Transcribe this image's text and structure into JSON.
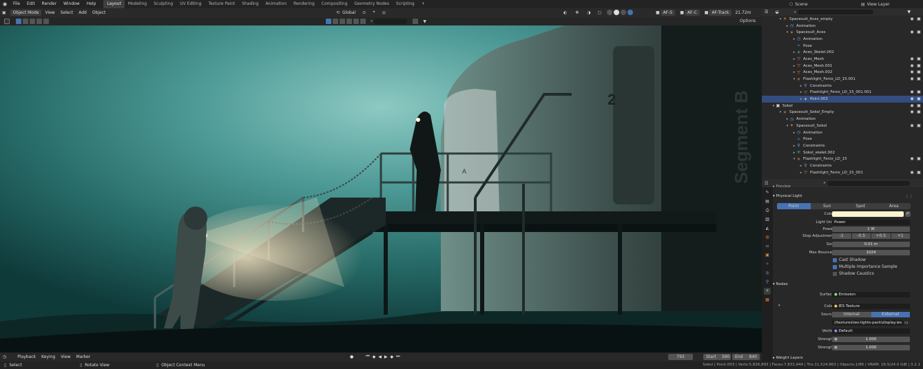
{
  "menu": [
    "File",
    "Edit",
    "Render",
    "Window",
    "Help"
  ],
  "workspaces": [
    "Layout",
    "Modeling",
    "Sculpting",
    "UV Editing",
    "Texture Paint",
    "Shading",
    "Animation",
    "Rendering",
    "Compositing",
    "Geometry Nodes",
    "Scripting"
  ],
  "workspace_add": "+",
  "scene": "Scene",
  "view_layer": "View Layer",
  "viewport_header": {
    "mode": "Object Mode",
    "menus": [
      "View",
      "Select",
      "Add",
      "Object"
    ],
    "orientation": "Global",
    "af_s": "AF-S",
    "af_c": "AF-C",
    "af_track": "AF-Track",
    "focal": "21.72m",
    "options": "Options"
  },
  "outliner": [
    {
      "label": "Spacesuit_Aces_empty",
      "indent": 1,
      "icon": "empty",
      "color": "#e58b3a",
      "caret": "▾",
      "vis": true
    },
    {
      "label": "Animation",
      "indent": 2,
      "icon": "anim",
      "color": "#6aa6e8",
      "caret": "▸",
      "vis": false
    },
    {
      "label": "Spacesuit_Aces",
      "indent": 2,
      "icon": "armature",
      "color": "#e58b3a",
      "caret": "▾",
      "vis": true
    },
    {
      "label": "Animation",
      "indent": 3,
      "icon": "anim",
      "color": "#6aa6e8",
      "caret": "▸",
      "vis": false
    },
    {
      "label": "Pose",
      "indent": 3,
      "icon": "pose",
      "color": "#6aa6e8",
      "caret": "",
      "vis": false
    },
    {
      "label": "Aces_Skelet.002",
      "indent": 3,
      "icon": "armdata",
      "color": "#3ec3a8",
      "caret": "▸",
      "vis": false
    },
    {
      "label": "Aces_Mesh",
      "indent": 3,
      "icon": "mesh",
      "color": "#e58b3a",
      "caret": "▸",
      "vis": true
    },
    {
      "label": "Aces_Mesh.001",
      "indent": 3,
      "icon": "mesh",
      "color": "#e58b3a",
      "caret": "▸",
      "vis": true
    },
    {
      "label": "Aces_Mesh.002",
      "indent": 3,
      "icon": "mesh",
      "color": "#e58b3a",
      "caret": "▸",
      "vis": true
    },
    {
      "label": "Flashlight_Fenix_LD_15.001",
      "indent": 3,
      "icon": "empty",
      "color": "#e58b3a",
      "caret": "▾",
      "vis": true
    },
    {
      "label": "Constraints",
      "indent": 4,
      "icon": "constraint",
      "color": "#6aa6e8",
      "caret": "▸",
      "vis": false
    },
    {
      "label": "Flashlight_Fenix_LD_15_001.001",
      "indent": 4,
      "icon": "mesh",
      "color": "#e58b3a",
      "caret": "▸",
      "vis": true
    },
    {
      "label": "Point.003",
      "indent": 4,
      "icon": "light",
      "color": "#e0e0a0",
      "caret": "▸",
      "vis": true,
      "selected": true
    },
    {
      "label": "Sokol",
      "indent": 0,
      "icon": "collection",
      "color": "#dddddd",
      "caret": "▾",
      "vis": true
    },
    {
      "label": "Spacesuit_Sokol_Empty",
      "indent": 1,
      "icon": "empty",
      "color": "#e58b3a",
      "caret": "▾",
      "vis": true
    },
    {
      "label": "Animation",
      "indent": 2,
      "icon": "anim",
      "color": "#6aa6e8",
      "caret": "▸",
      "vis": false
    },
    {
      "label": "Spacesuit_Sokol",
      "indent": 2,
      "icon": "armature",
      "color": "#e58b3a",
      "caret": "▾",
      "vis": true
    },
    {
      "label": "Animation",
      "indent": 3,
      "icon": "anim",
      "color": "#6aa6e8",
      "caret": "▸",
      "vis": false
    },
    {
      "label": "Pose",
      "indent": 3,
      "icon": "pose",
      "color": "#6aa6e8",
      "caret": "",
      "vis": false
    },
    {
      "label": "Constraints",
      "indent": 3,
      "icon": "constraint",
      "color": "#6aa6e8",
      "caret": "▸",
      "vis": false
    },
    {
      "label": "Sokol_skelet.002",
      "indent": 3,
      "icon": "armdata",
      "color": "#3ec3a8",
      "caret": "▸",
      "vis": false
    },
    {
      "label": "Flashlight_Fenix_LD_15",
      "indent": 3,
      "icon": "empty",
      "color": "#e58b3a",
      "caret": "▾",
      "vis": true
    },
    {
      "label": "Constraints",
      "indent": 4,
      "icon": "constraint",
      "color": "#6aa6e8",
      "caret": "▸",
      "vis": false
    },
    {
      "label": "Flashlight_Fenix_LD_15_001",
      "indent": 4,
      "icon": "mesh",
      "color": "#e58b3a",
      "caret": "▸",
      "vis": true
    }
  ],
  "properties": {
    "preview": "Preview",
    "physical_light": "Physical Light",
    "light_types": [
      "Point",
      "Sun",
      "Spot",
      "Area"
    ],
    "active_type": "Point",
    "color_label": "Color",
    "color_value": "#fff4d0",
    "light_unit_label": "Light Unit",
    "light_unit": "Power",
    "power_label": "Power",
    "power": "1 W",
    "stop_label": "Stop Adjustment",
    "stops": [
      "-1",
      "-0.5",
      "+0.5",
      "+1"
    ],
    "size_label": "Size",
    "size": "0.01 m",
    "bounces_label": "Max Bounces",
    "bounces": "1024",
    "cast_shadow": "Cast Shadow",
    "mis": "Multiple Importance Sample",
    "caustics": "Shadow Caustics",
    "nodes": "Nodes",
    "surface_label": "Surface",
    "surface": "Emission",
    "ncolor_label": "Color",
    "ies": "IES Texture",
    "source_label": "Source",
    "sources": [
      "Internal",
      "External"
    ],
    "active_source": "External",
    "filepath": "//textures\\ies-lights-pack\\display.ies",
    "vector_label": "Vector",
    "vector": "Default",
    "strength_label": "Strength",
    "strength1": "1.000",
    "strength2": "1.000",
    "weight_layers": "Weight Layers"
  },
  "timeline": {
    "menus": [
      "Playback",
      "Keying",
      "View",
      "Marker"
    ],
    "frame": "793",
    "start_label": "Start",
    "start": "390",
    "end_label": "End",
    "end": "840"
  },
  "status": {
    "select": "Select",
    "rotate": "Rotate View",
    "context": "Object Context Menu",
    "stats": "Sokol | Point.003 | Verts:5,826,893 | Faces:7,833,944 | Tris:11,524,863 | Objects:1/86 | VRAM: 16.5/24.0 GiB | 3.2.1"
  },
  "viewport_text": {
    "number": "2",
    "segment": "Segment B",
    "letter": "A"
  }
}
